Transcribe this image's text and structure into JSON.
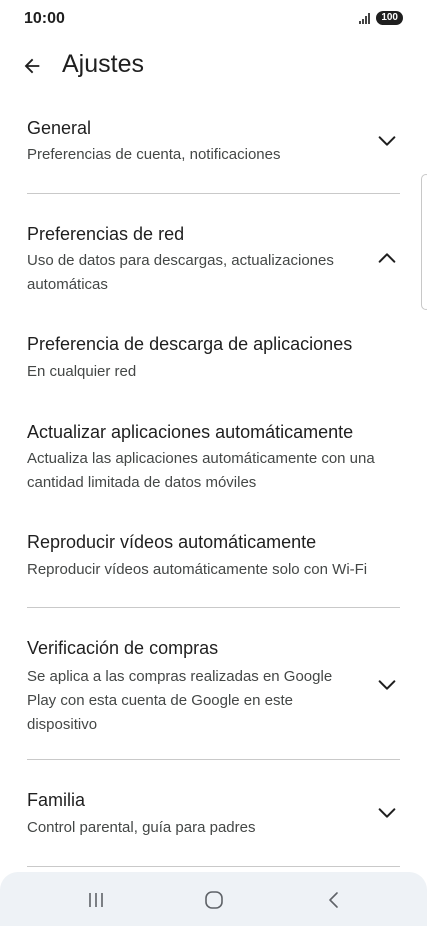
{
  "status_bar": {
    "time": "10:00",
    "battery": "100",
    "signal_icon": "signal-icon"
  },
  "header": {
    "title": "Ajustes",
    "back_icon": "arrow-back-icon"
  },
  "sections": [
    {
      "title": "General",
      "subtitle": "Preferencias de cuenta, notificaciones",
      "state": "collapsed",
      "icon": "chevron-down-icon"
    },
    {
      "title": "Preferencias de red",
      "subtitle": "Uso de datos para descargas, actualizaciones automáticas",
      "state": "expanded",
      "icon": "chevron-up-icon",
      "items": [
        {
          "title": "Preferencia de descarga de aplicaciones",
          "subtitle": "En cualquier red"
        },
        {
          "title": "Actualizar aplicaciones automáticamente",
          "subtitle": "Actualiza las aplicaciones automáticamente con una cantidad limitada de datos móviles"
        },
        {
          "title": "Reproducir vídeos automáticamente",
          "subtitle": "Reproducir vídeos automáticamente solo con Wi-Fi"
        }
      ]
    },
    {
      "title": "Verificación de compras",
      "subtitle": "Se aplica a las compras realizadas en Google Play con esta cuenta de Google en este dispositivo",
      "state": "collapsed",
      "icon": "chevron-down-icon"
    },
    {
      "title": "Familia",
      "subtitle": "Control parental, guía para padres",
      "state": "collapsed",
      "icon": "chevron-down-icon"
    }
  ],
  "nav_bar": {
    "recents_icon": "recents-icon",
    "home_icon": "home-icon",
    "back_icon": "nav-back-icon"
  },
  "colors": {
    "text_primary": "#1f1f1f",
    "text_secondary": "#444746",
    "divider": "#c9c9c9",
    "nav_bar_bg": "#eef2f6"
  }
}
